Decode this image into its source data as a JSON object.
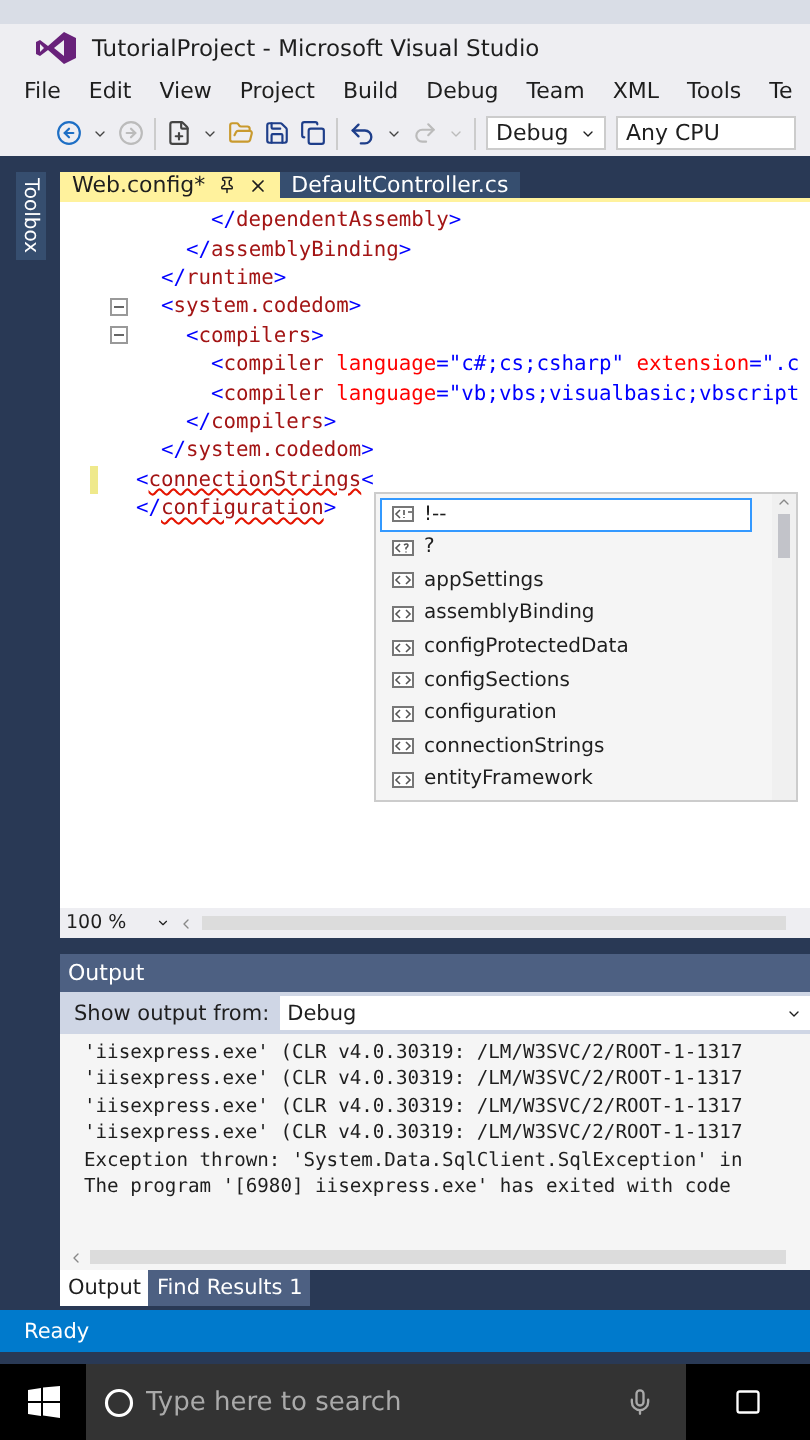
{
  "window": {
    "title": "TutorialProject - Microsoft Visual Studio"
  },
  "background_window": {
    "visible": true
  },
  "menu": [
    "File",
    "Edit",
    "View",
    "Project",
    "Build",
    "Debug",
    "Team",
    "XML",
    "Tools",
    "Te"
  ],
  "toolbar": {
    "configuration": "Debug",
    "platform": "Any CPU"
  },
  "side_panel": {
    "label": "Toolbox"
  },
  "tabs": [
    {
      "label": "Web.config*",
      "selected": true
    },
    {
      "label": "DefaultController.cs",
      "selected": false
    }
  ],
  "code_lines": [
    {
      "fold": false,
      "modified": false,
      "squiggly": false,
      "tokens": [
        {
          "kind": "punct",
          "text": "      </"
        },
        {
          "kind": "tag",
          "text": "dependentAssembly"
        },
        {
          "kind": "punct",
          "text": ">"
        }
      ]
    },
    {
      "fold": false,
      "modified": false,
      "squiggly": false,
      "tokens": [
        {
          "kind": "punct",
          "text": "    </"
        },
        {
          "kind": "tag",
          "text": "assemblyBinding"
        },
        {
          "kind": "punct",
          "text": ">"
        }
      ]
    },
    {
      "fold": false,
      "modified": false,
      "squiggly": false,
      "tokens": [
        {
          "kind": "punct",
          "text": "  </"
        },
        {
          "kind": "tag",
          "text": "runtime"
        },
        {
          "kind": "punct",
          "text": ">"
        }
      ]
    },
    {
      "fold": true,
      "modified": false,
      "squiggly": false,
      "tokens": [
        {
          "kind": "punct",
          "text": "  <"
        },
        {
          "kind": "tag",
          "text": "system.codedom"
        },
        {
          "kind": "punct",
          "text": ">"
        }
      ]
    },
    {
      "fold": true,
      "modified": false,
      "squiggly": false,
      "tokens": [
        {
          "kind": "punct",
          "text": "    <"
        },
        {
          "kind": "tag",
          "text": "compilers"
        },
        {
          "kind": "punct",
          "text": ">"
        }
      ]
    },
    {
      "fold": false,
      "modified": false,
      "squiggly": false,
      "tokens": [
        {
          "kind": "punct",
          "text": "      <"
        },
        {
          "kind": "tag",
          "text": "compiler"
        },
        {
          "kind": "attr",
          "text": " language"
        },
        {
          "kind": "punct",
          "text": "="
        },
        {
          "kind": "value",
          "text": "\"c#;cs;csharp\""
        },
        {
          "kind": "attr",
          "text": " extension"
        },
        {
          "kind": "punct",
          "text": "="
        },
        {
          "kind": "value",
          "text": "\".c"
        }
      ]
    },
    {
      "fold": false,
      "modified": false,
      "squiggly": false,
      "tokens": [
        {
          "kind": "punct",
          "text": "      <"
        },
        {
          "kind": "tag",
          "text": "compiler"
        },
        {
          "kind": "attr",
          "text": " language"
        },
        {
          "kind": "punct",
          "text": "="
        },
        {
          "kind": "value",
          "text": "\"vb;vbs;visualbasic;vbscript"
        }
      ]
    },
    {
      "fold": false,
      "modified": false,
      "squiggly": false,
      "tokens": [
        {
          "kind": "punct",
          "text": "    </"
        },
        {
          "kind": "tag",
          "text": "compilers"
        },
        {
          "kind": "punct",
          "text": ">"
        }
      ]
    },
    {
      "fold": false,
      "modified": false,
      "squiggly": false,
      "tokens": [
        {
          "kind": "punct",
          "text": "  </"
        },
        {
          "kind": "tag",
          "text": "system.codedom"
        },
        {
          "kind": "punct",
          "text": ">"
        }
      ]
    },
    {
      "fold": false,
      "modified": true,
      "squiggly": true,
      "tokens": [
        {
          "kind": "punct",
          "text": "<"
        },
        {
          "kind": "tag",
          "text": "connectionStrings"
        },
        {
          "kind": "punct",
          "text": "<"
        }
      ]
    },
    {
      "fold": false,
      "modified": false,
      "squiggly": true,
      "tokens": [
        {
          "kind": "punct",
          "text": "</"
        },
        {
          "kind": "tag",
          "text": "configuration"
        },
        {
          "kind": "punct",
          "text": ">"
        }
      ]
    }
  ],
  "completion": [
    {
      "label": "!--",
      "kind": "comment",
      "selected": true
    },
    {
      "label": "?",
      "kind": "instruction",
      "selected": false
    },
    {
      "label": "appSettings",
      "kind": "element",
      "selected": false
    },
    {
      "label": "assemblyBinding",
      "kind": "element",
      "selected": false
    },
    {
      "label": "configProtectedData",
      "kind": "element",
      "selected": false
    },
    {
      "label": "configSections",
      "kind": "element",
      "selected": false
    },
    {
      "label": "configuration",
      "kind": "element",
      "selected": false
    },
    {
      "label": "connectionStrings",
      "kind": "element",
      "selected": false
    },
    {
      "label": "entityFramework",
      "kind": "element",
      "selected": false
    }
  ],
  "zoom": "100 %",
  "output": {
    "title": "Output",
    "source_label": "Show output from:",
    "source": "Debug",
    "lines": [
      "'iisexpress.exe' (CLR v4.0.30319: /LM/W3SVC/2/ROOT-1-1317",
      "'iisexpress.exe' (CLR v4.0.30319: /LM/W3SVC/2/ROOT-1-1317",
      "'iisexpress.exe' (CLR v4.0.30319: /LM/W3SVC/2/ROOT-1-1317",
      "'iisexpress.exe' (CLR v4.0.30319: /LM/W3SVC/2/ROOT-1-1317",
      "Exception thrown: 'System.Data.SqlClient.SqlException' in",
      "The program '[6980] iisexpress.exe' has exited with code"
    ]
  },
  "bottom_tabs": [
    {
      "label": "Output",
      "selected": true
    },
    {
      "label": "Find Results 1",
      "selected": false
    }
  ],
  "status_bar": "Ready",
  "taskbar": {
    "search_placeholder": "Type here to search"
  }
}
